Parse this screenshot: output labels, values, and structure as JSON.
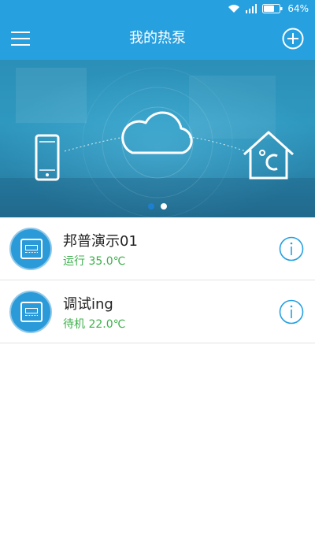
{
  "status_bar": {
    "battery_text": "64%",
    "icons": [
      "wifi-icon",
      "signal-icon",
      "battery-icon"
    ]
  },
  "app_bar": {
    "title": "我的热泵",
    "menu_icon": "menu-icon",
    "add_icon": "plus-circle-icon"
  },
  "banner": {
    "icons": [
      "phone-icon",
      "cloud-icon",
      "house-thermometer-icon"
    ],
    "page_count": 2,
    "active_page": 0
  },
  "devices": [
    {
      "name": "邦普演示01",
      "status": "运行 35.0℃"
    },
    {
      "name": "调试ing",
      "status": "待机 22.0℃"
    }
  ],
  "colors": {
    "primary": "#27a0e0",
    "status_green": "#3bb04a",
    "divider": "#e3e3e3"
  }
}
